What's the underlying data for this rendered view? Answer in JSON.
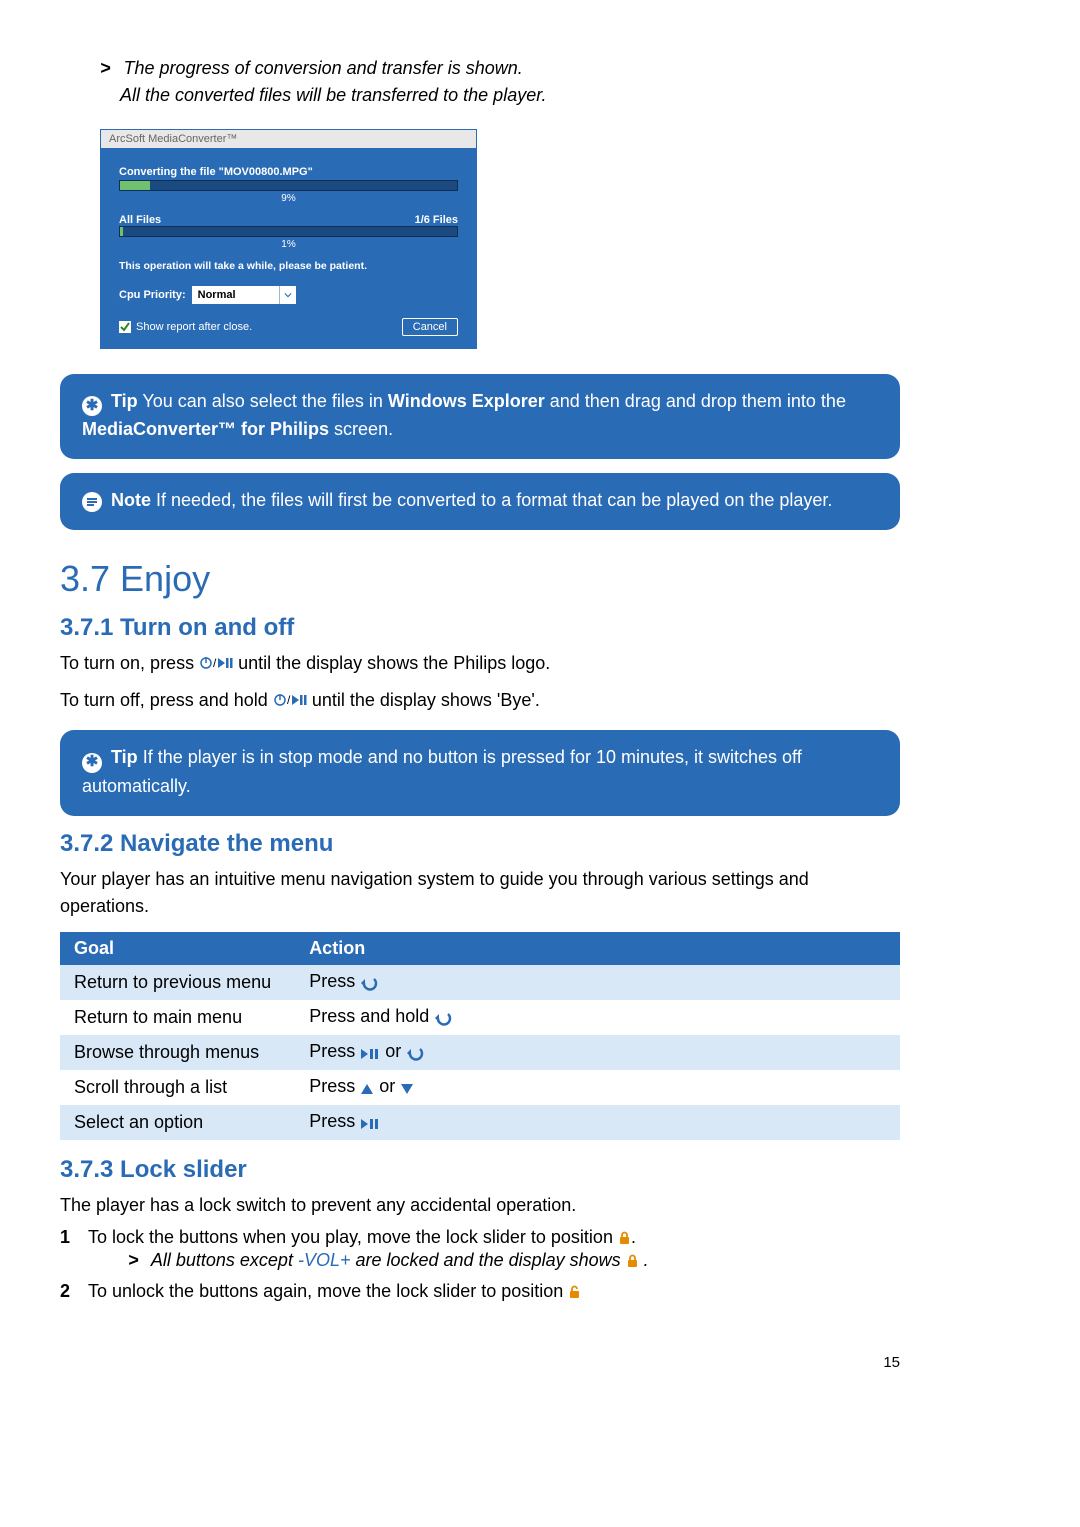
{
  "intro": {
    "line1": "The progress of conversion and transfer is shown.",
    "line2": "All the converted files will be transferred to the player."
  },
  "dialog": {
    "title": "ArcSoft MediaConverter™",
    "converting_label": "Converting the file \"MOV00800.MPG\"",
    "converting_pct": "9%",
    "all_files_label": "All Files",
    "all_files_count": "1/6 Files",
    "all_files_pct": "1%",
    "patience": "This operation will take a while, please be patient.",
    "cpu_priority_label": "Cpu Priority:",
    "cpu_priority_value": "Normal",
    "show_report": "Show report after close.",
    "cancel": "Cancel"
  },
  "tip1": {
    "lead": "Tip",
    "t1": "You can also select the files in ",
    "b1": "Windows Explorer",
    "t2": " and then drag and drop them into the ",
    "b2": "MediaConverter™ for Philips",
    "t3": " screen."
  },
  "note1": {
    "lead": "Note",
    "text": " If needed, the files will first be converted to a format that can be played on the player."
  },
  "s37": {
    "title": "3.7  Enjoy",
    "s371_title": "3.7.1 Turn on and off",
    "turn_on_pre": "To turn on, press ",
    "turn_on_post": " until the display shows the Philips logo.",
    "turn_off_pre": "To turn off, press and hold ",
    "turn_off_post": " until the display shows 'Bye'."
  },
  "tip2": {
    "lead": "Tip",
    "text": " If the player is in stop mode and no button is pressed for 10 minutes, it switches off automatically."
  },
  "s372": {
    "title": "3.7.2 Navigate the menu",
    "intro": "Your player has an intuitive menu navigation system to guide you through various settings and operations.",
    "col_goal": "Goal",
    "col_action": "Action",
    "rows": [
      {
        "goal": "Return to previous menu",
        "action_pre": "Press ",
        "icon": "back"
      },
      {
        "goal": "Return to main menu",
        "action_pre": "Press and hold ",
        "icon": "back"
      },
      {
        "goal": "Browse through menus",
        "action_pre": "Press ",
        "icon": "playpause_or_back"
      },
      {
        "goal": "Scroll through a list",
        "action_pre": "Press ",
        "icon": "up_or_down"
      },
      {
        "goal": "Select an option",
        "action_pre": "Press ",
        "icon": "playpause"
      }
    ]
  },
  "s373": {
    "title": "3.7.3 Lock slider",
    "intro": "The player has a lock switch to prevent any accidental operation.",
    "step1": "To lock the buttons when you play, move the lock slider to position ",
    "step1_sub_pre": "All buttons except ",
    "step1_sub_vol": "-VOL+",
    "step1_sub_post": " are locked and the display shows ",
    "step2": "To unlock the buttons again, move the lock slider to position "
  },
  "page_number": "15"
}
